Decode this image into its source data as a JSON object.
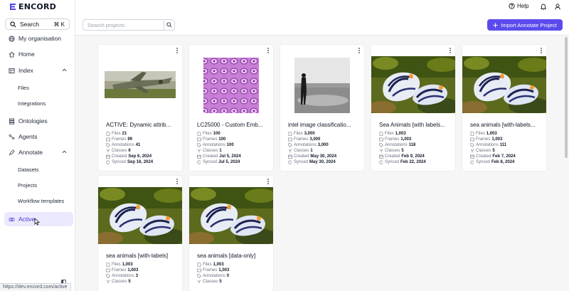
{
  "app": {
    "logo_text": "ENCORD"
  },
  "sidebar": {
    "search_label": "Search",
    "search_shortcut": "⌘ K",
    "items": [
      {
        "label": "My organisation"
      },
      {
        "label": "Home"
      },
      {
        "label": "Index"
      },
      {
        "label": "Files"
      },
      {
        "label": "Integrations"
      },
      {
        "label": "Ontologies"
      },
      {
        "label": "Agents"
      },
      {
        "label": "Annotate"
      },
      {
        "label": "Datasets"
      },
      {
        "label": "Projects"
      },
      {
        "label": "Workflow templates"
      },
      {
        "label": "Active"
      }
    ]
  },
  "header": {
    "help_label": "Help"
  },
  "toolbar": {
    "search_placeholder": "Search projects",
    "import_label": "Import Annotate Project"
  },
  "status_url": "https://dev.encord.com/active",
  "meta_labels": {
    "files": "Files",
    "frames": "Frames",
    "annotations": "Annotations",
    "classes": "Classes",
    "created": "Created",
    "synced": "Synced"
  },
  "colors": {
    "accent": "#5b4bed",
    "active_bg": "#ebe9fe"
  },
  "projects": [
    {
      "title": "ACTIVE: Dynamic attrib...",
      "thumbnail": "fighter-jet",
      "files": "21",
      "frames": "99",
      "annotations": "41",
      "classes": "6",
      "created": "Sep 6, 2024",
      "synced": "Sep 18, 2024"
    },
    {
      "title": "LC25000 - Custom Emb...",
      "thumbnail": "histology",
      "files": "100",
      "frames": "100",
      "annotations": "100",
      "classes": "1",
      "created": "Jul 5, 2024",
      "synced": "Jul 5, 2024"
    },
    {
      "title": "intel image classificatio...",
      "thumbnail": "beach-silhouette",
      "files": "3,000",
      "frames": "3,000",
      "annotations": "3,000",
      "classes": "1",
      "created": "May 30, 2024",
      "synced": "May 30, 2024"
    },
    {
      "title": "Sea Animals [with labels...",
      "thumbnail": "sea-slug",
      "files": "1,003",
      "frames": "1,003",
      "annotations": "118",
      "classes": "5",
      "created": "Feb 9, 2024",
      "synced": "Feb 22, 2024"
    },
    {
      "title": "sea animals [with-labels...",
      "thumbnail": "sea-slug",
      "files": "1,003",
      "frames": "1,003",
      "annotations": "111",
      "classes": "5",
      "created": "Feb 7, 2024",
      "synced": "Feb 8, 2024"
    },
    {
      "title": "sea animals [with-labels]",
      "thumbnail": "sea-slug",
      "files": "1,003",
      "frames": "1,003",
      "annotations": "3",
      "classes": "5"
    },
    {
      "title": "sea animals [data-only]",
      "thumbnail": "sea-slug",
      "files": "1,003",
      "frames": "1,003",
      "annotations": "0",
      "classes": "5"
    }
  ]
}
